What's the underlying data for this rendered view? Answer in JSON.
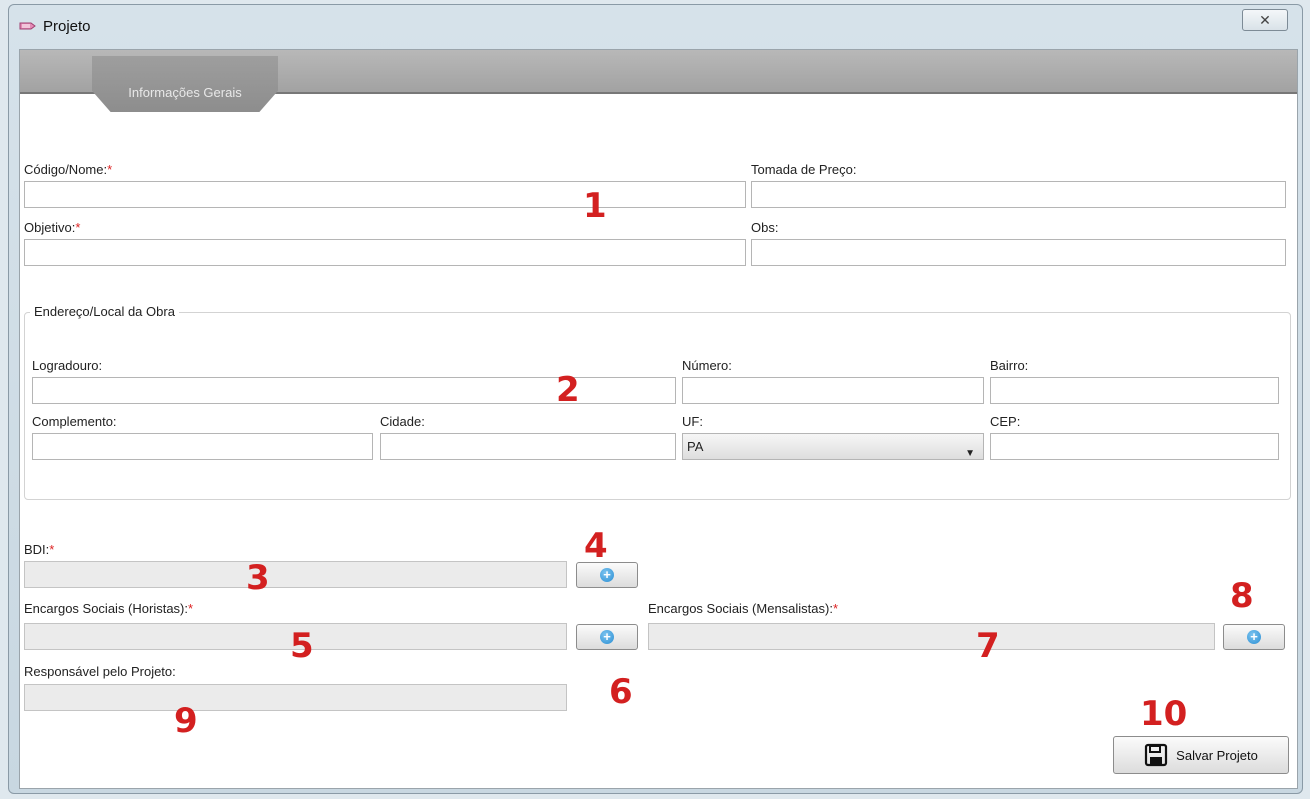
{
  "window": {
    "title": "Projeto",
    "close_glyph": "✕"
  },
  "tabs": [
    {
      "label": "Informações Gerais"
    }
  ],
  "form": {
    "codigo_label": "Código/Nome:",
    "tomada_label": "Tomada de Preço:",
    "objetivo_label": "Objetivo:",
    "obs_label": "Obs:",
    "required_mark": "*",
    "codigo_value": "",
    "tomada_value": "",
    "objetivo_value": "",
    "obs_value": ""
  },
  "address": {
    "group_title": "Endereço/Local da Obra",
    "logradouro_label": "Logradouro:",
    "numero_label": "Número:",
    "bairro_label": "Bairro:",
    "complemento_label": "Complemento:",
    "cidade_label": "Cidade:",
    "uf_label": "UF:",
    "cep_label": "CEP:",
    "uf_value": "PA"
  },
  "bdi": {
    "label": "BDI:"
  },
  "encargos": {
    "horistas_label": "Encargos Sociais (Horistas):",
    "mensalistas_label": "Encargos Sociais (Mensalistas):"
  },
  "responsavel": {
    "label": "Responsável pelo Projeto:"
  },
  "save": {
    "label": "Salvar Projeto"
  },
  "markers": [
    "1",
    "2",
    "3",
    "4",
    "5",
    "6",
    "7",
    "8",
    "9",
    "10"
  ],
  "icons": {
    "title": "project-icon",
    "add": "plus-circle-icon",
    "save": "floppy-disk-icon"
  },
  "colors": {
    "marker": "#d32020",
    "required": "#dd2222",
    "plus": "#2c8fd3"
  }
}
